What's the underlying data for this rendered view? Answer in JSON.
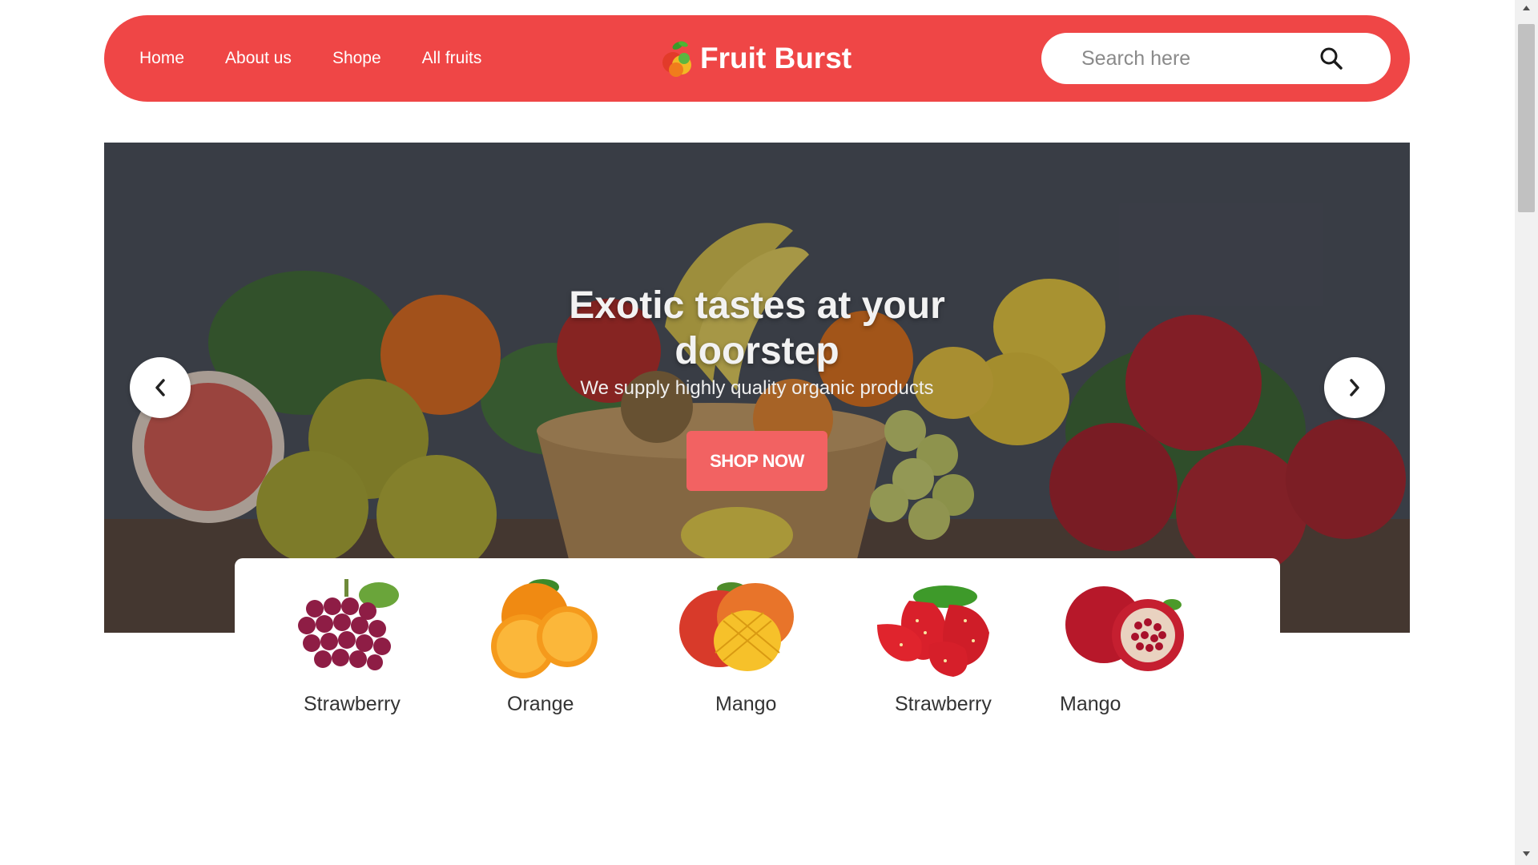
{
  "header": {
    "nav": [
      {
        "label": "Home"
      },
      {
        "label": "About us"
      },
      {
        "label": "Shope"
      },
      {
        "label": "All fruits"
      }
    ],
    "brand": "Fruit Burst",
    "search": {
      "placeholder": "Search here",
      "value": ""
    }
  },
  "hero": {
    "title": "Exotic tastes at your doorstep",
    "subtitle": "We supply highly quality organic products",
    "cta": "SHOP NOW",
    "prev_icon": "chevron-left-icon",
    "next_icon": "chevron-right-icon"
  },
  "categories": [
    {
      "label": "Strawberry",
      "image": "grapes"
    },
    {
      "label": "Orange",
      "image": "orange"
    },
    {
      "label": "Mango",
      "image": "mango"
    },
    {
      "label": "Strawberry",
      "image": "strawberry"
    },
    {
      "label": "Mango",
      "image": "pomegranate"
    }
  ],
  "colors": {
    "brand_red": "#ef4646",
    "cta_red": "#f26262",
    "white": "#ffffff"
  }
}
